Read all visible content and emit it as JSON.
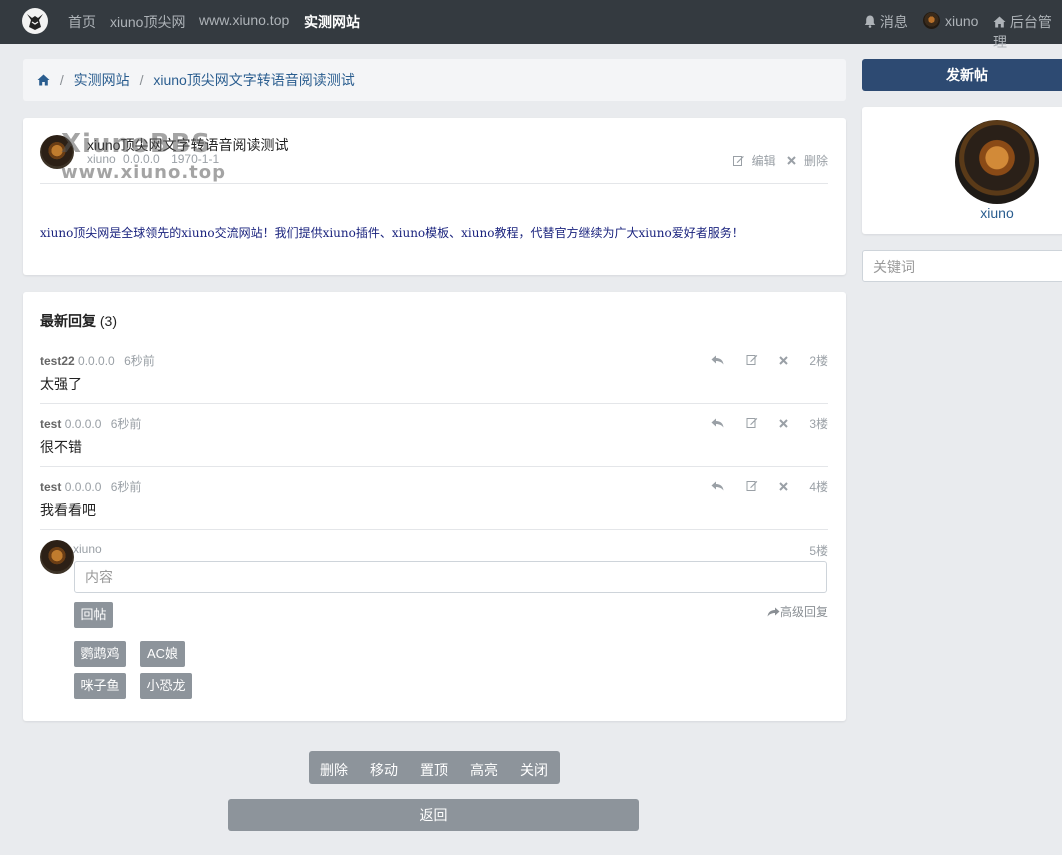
{
  "nav": {
    "links": [
      "首页",
      "xiuno顶尖网",
      "www.xiuno.top",
      "实测网站"
    ],
    "messages": "消息",
    "user": "xiuno",
    "admin": "后台管理"
  },
  "breadcrumb": {
    "forum": "实测网站",
    "thread": "xiuno顶尖网文字转语音阅读测试"
  },
  "thread": {
    "title": "xiuno顶尖网文字转语音阅读测试",
    "author": "xiuno",
    "ip": "0.0.0.0",
    "date": "1970-1-1",
    "edit": "编辑",
    "delete": "删除",
    "body": "xiuno顶尖网是全球领先的xiuno交流网站！我们提供xiuno插件、xiuno模板、xiuno教程，代替官方继续为广大xiuno爱好者服务！",
    "watermark_line1": "XiunoBBS",
    "watermark_line2": "www.xiuno.top"
  },
  "replies": {
    "heading": "最新回复",
    "count": "(3)",
    "items": [
      {
        "user": "test22",
        "ip": "0.0.0.0",
        "time": "6秒前",
        "content": "太强了",
        "floor": "2楼"
      },
      {
        "user": "test",
        "ip": "0.0.0.0",
        "time": "6秒前",
        "content": "很不错",
        "floor": "3楼"
      },
      {
        "user": "test",
        "ip": "0.0.0.0",
        "time": "6秒前",
        "content": "我看看吧",
        "floor": "4楼"
      }
    ],
    "compose": {
      "user": "xiuno",
      "floor": "5楼",
      "placeholder": "内容",
      "submit": "回帖",
      "advanced": "高级回复",
      "stickers": [
        "鹦鹉鸡",
        "AC娘",
        "咪子鱼",
        "小恐龙"
      ]
    }
  },
  "moderation": [
    "删除",
    "移动",
    "置顶",
    "高亮",
    "关闭"
  ],
  "back": "返回",
  "sidebar": {
    "new_thread": "发新帖",
    "username": "xiuno",
    "search_placeholder": "关键词"
  }
}
